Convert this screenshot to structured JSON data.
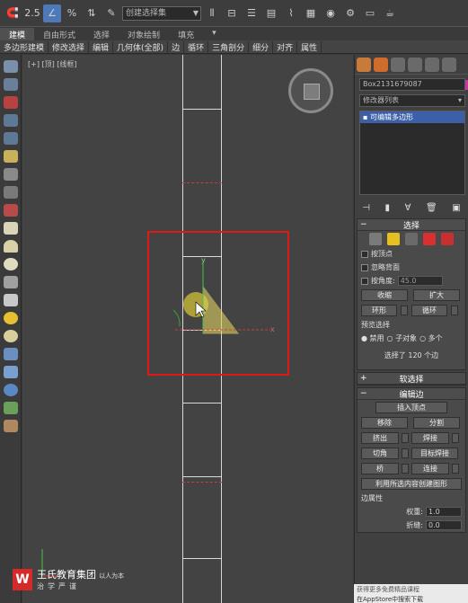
{
  "toolbar": {
    "num_1": "2.5",
    "num_2": "3",
    "percent": "%",
    "selection_set": "创建选择集"
  },
  "ribbon": {
    "tabs": [
      "建模",
      "自由形式",
      "选择",
      "对象绘制",
      "填充"
    ],
    "sub_items": [
      "多边形建模",
      "修改选择",
      "编辑",
      "几何体(全部)",
      "边",
      "循环",
      "三角剖分",
      "细分",
      "对齐",
      "属性"
    ]
  },
  "viewport": {
    "label": "[+] [顶] [线框]",
    "axis_x": "x",
    "axis_y": "y"
  },
  "panel": {
    "object_name": "Box2131679087",
    "modifier_list": "修改器列表",
    "stack_item": "可编辑多边形",
    "selection_header": "选择",
    "by_vertex": "按顶点",
    "ignore_backface": "忽略背面",
    "by_angle": "按角度:",
    "angle_value": "45.0",
    "shrink": "收缩",
    "grow": "扩大",
    "ring": "环形",
    "loop": "循环",
    "preview_selection": "预览选择",
    "preview_disabled": "禁用",
    "preview_subobject": "子对象",
    "preview_multi": "多个",
    "selected_count": "选择了 120 个边",
    "soft_selection": "软选择",
    "edit_edges": "编辑边",
    "insert_vertex": "插入顶点",
    "remove": "移除",
    "split": "分割",
    "extrude": "挤出",
    "weld": "焊接",
    "chamfer": "切角",
    "target_weld": "目标焊接",
    "bridge": "桥",
    "connect": "连接",
    "create_shape": "利用所选内容创建图形",
    "edge_props": "边属性",
    "weight": "权重:",
    "weight_value": "1.0",
    "crease": "折缝:",
    "crease_value": "0.0"
  },
  "logo": {
    "name": "王氏教育集团",
    "slogan": "以人为本",
    "sub": "治学严谨"
  },
  "watermark": {
    "text": "在AppStore中搜索下载",
    "line2": "获得更多免费精品课程"
  },
  "colors": {
    "accent": "#4e79b8",
    "selection_red": "#e01818",
    "stack_blue": "#3d5fa8",
    "modify_tab": "#cf6b2b"
  }
}
